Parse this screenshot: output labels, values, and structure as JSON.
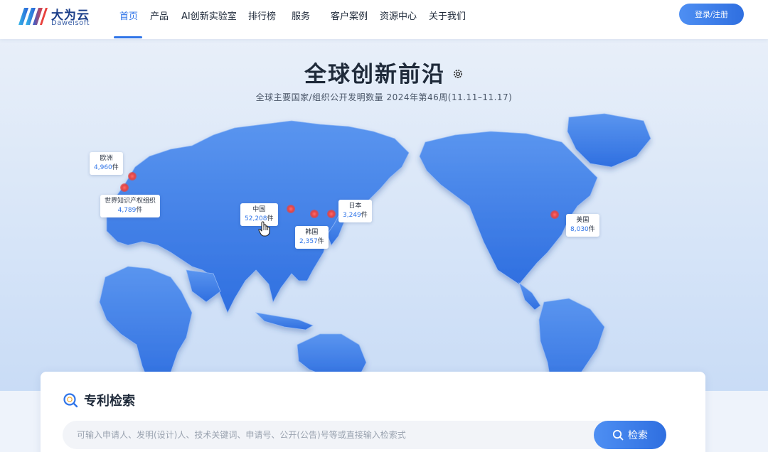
{
  "header": {
    "logo_cn": "大为云",
    "logo_en": "Daweisoft",
    "nav": [
      {
        "label": "首页",
        "active": true
      },
      {
        "label": "产品",
        "active": false
      },
      {
        "label": "AI创新实验室",
        "active": false
      },
      {
        "label": "排行榜",
        "active": false
      },
      {
        "label": "服务",
        "active": false
      },
      {
        "label": "客户案例",
        "active": false
      },
      {
        "label": "资源中心",
        "active": false
      },
      {
        "label": "关于我们",
        "active": false
      }
    ],
    "login_label": "登录/注册"
  },
  "hero": {
    "title": "全球创新前沿",
    "subtitle": "全球主要国家/组织公开发明数量 2024年第46周(11.11–11.17)",
    "settings_icon": "gear-icon",
    "callouts": [
      {
        "name": "欧洲",
        "count": "4,960",
        "unit": "件"
      },
      {
        "name": "世界知识产权组织",
        "count": "4,789",
        "unit": "件"
      },
      {
        "name": "中国",
        "count": "52,208",
        "unit": "件"
      },
      {
        "name": "日本",
        "count": "3,249",
        "unit": "件"
      },
      {
        "name": "韩国",
        "count": "2,357",
        "unit": "件"
      },
      {
        "name": "美国",
        "count": "8,030",
        "unit": "件"
      }
    ]
  },
  "search": {
    "title": "专利检索",
    "placeholder": "可输入申请人、发明(设计)人、技术关键词、申请号、公开(公告)号等或直接输入检索式",
    "button_label": "检索"
  },
  "colors": {
    "accent": "#2f74e8",
    "map_land": "#3c7ee8",
    "hotspot": "#e34545",
    "background": "#e8eff9"
  }
}
